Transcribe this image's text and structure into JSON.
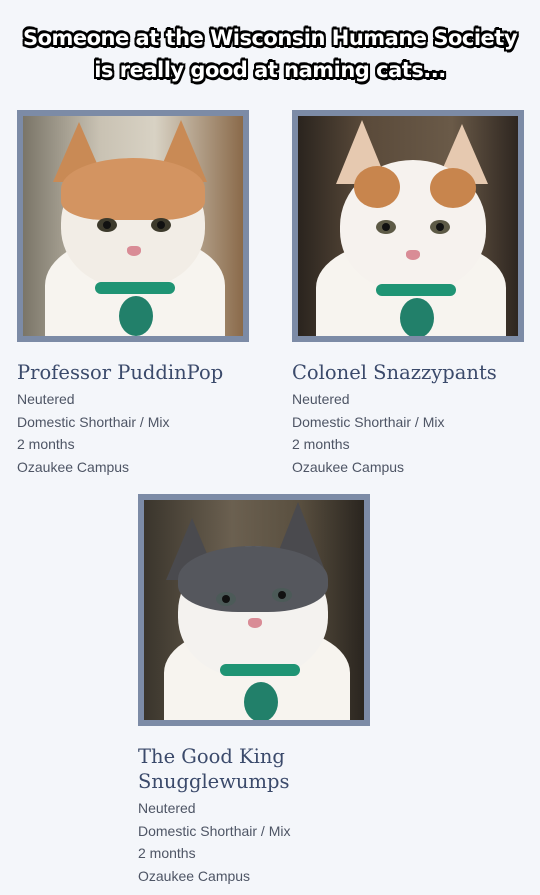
{
  "caption": {
    "line1": "Someone at the Wisconsin Humane Society",
    "line2": "is really good at naming cats..."
  },
  "cats": [
    {
      "name": "Professor PuddinPop",
      "status": "Neutered",
      "breed": "Domestic Shorthair / Mix",
      "age": "2 months",
      "location": "Ozaukee Campus",
      "photo_icon": "orange-white-kitten-photo"
    },
    {
      "name": "Colonel Snazzypants",
      "status": "Neutered",
      "breed": "Domestic Shorthair / Mix",
      "age": "2 months",
      "location": "Ozaukee Campus",
      "photo_icon": "white-orange-kitten-photo"
    },
    {
      "name_line1": "The Good King",
      "name_line2": "Snugglewumps",
      "status": "Neutered",
      "breed": "Domestic Shorthair / Mix",
      "age": "2 months",
      "location": "Ozaukee Campus",
      "photo_icon": "gray-white-kitten-photo"
    }
  ],
  "colors": {
    "background": "#f4f6fa",
    "frame": "#7c8ba6",
    "name_text": "#3b4a6b",
    "detail_text": "#4e5565",
    "collar": "#1f9474"
  }
}
